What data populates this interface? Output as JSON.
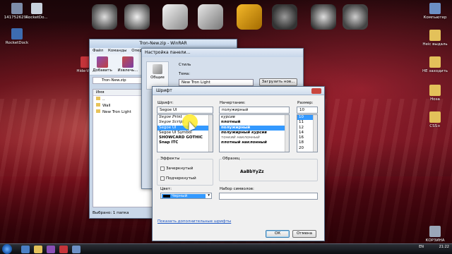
{
  "desktop": {
    "icons_left": [
      {
        "label": "141752629..."
      },
      {
        "label": "RocketDo..."
      },
      {
        "label": "RocketDock"
      },
      {
        "label": "Hide-VN..."
      }
    ],
    "icons_right": [
      {
        "label": "Компьютер"
      },
      {
        "label": "Неіс выдаль"
      },
      {
        "label": "НЕ заходить"
      },
      {
        "label": "Ноза"
      },
      {
        "label": "CSS+"
      },
      {
        "label": "КОРЗИНА"
      }
    ]
  },
  "winrar": {
    "title": "Tron-New.zip - WinRAR",
    "menu": [
      "Файл",
      "Команды",
      "Опера"
    ],
    "toolbar": [
      {
        "label": "Добавить"
      },
      {
        "label": "Извлечь..."
      }
    ],
    "path": "Tron-New.zip",
    "list_header": "Имя",
    "rows": [
      "..",
      "Wall",
      "New Tron Light"
    ],
    "status": "Выбрано: 1 папка"
  },
  "settings": {
    "title": "Настройка панели...",
    "side_label": "Общие",
    "style_label": "Стиль",
    "theme_label": "Тема:",
    "theme_value": "New Tron Light",
    "load_button": "Загрузить нов..."
  },
  "font_dialog": {
    "title": "Шрифт",
    "font_label": "Шрифт:",
    "style_label": "Начертание:",
    "size_label": "Размер:",
    "font_value": "Segoe UI",
    "style_value": "полужирный",
    "size_value": "10",
    "fonts": [
      "Segoe Print",
      "Segoe Script",
      "Segoe UI",
      "Segoe UI Symbol",
      "SHOWCARD GOTHIC",
      "Snap ITC"
    ],
    "selected_font_index": 2,
    "styles": [
      "курсив",
      "плотный",
      "полужирный",
      "полужирный курсив",
      "тонкий наклонный",
      "плотный наклонный"
    ],
    "selected_style_index": 2,
    "sizes": [
      "10",
      "11",
      "12",
      "14",
      "16",
      "18",
      "20"
    ],
    "selected_size_index": 0,
    "effects_label": "Эффекты",
    "strikeout_label": "Зачеркнутый",
    "underline_label": "Подчеркнутый",
    "color_label": "Цвет:",
    "color_value": "Черный",
    "sample_label": "Образец",
    "sample_text": "AaBbYyZz",
    "charset_label": "Набор символов:",
    "more_fonts_link": "Показать дополнительные шрифты",
    "ok_button": "ОК",
    "cancel_button": "Отмена"
  },
  "taskbar": {
    "lang": "EN",
    "time": "21:22"
  }
}
